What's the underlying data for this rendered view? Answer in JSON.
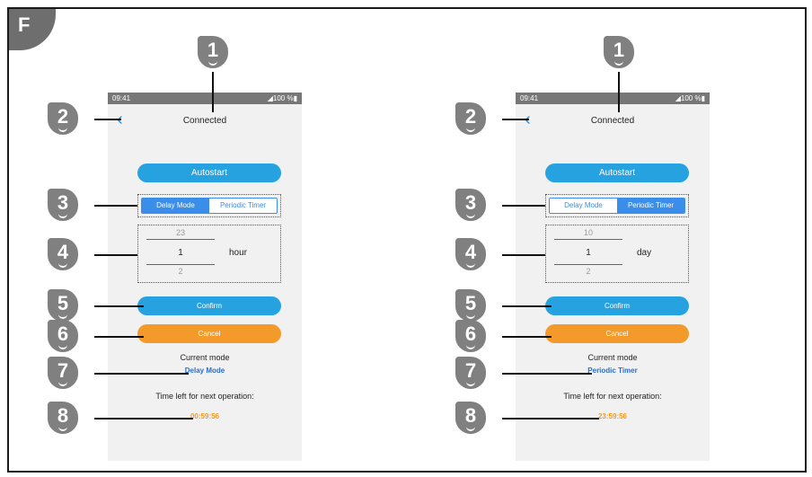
{
  "figure_label": "F",
  "panels": [
    {
      "status": {
        "time": "09:41",
        "battery": "100 %"
      },
      "title": "Connected",
      "autostart_label": "Autostart",
      "modes": [
        "Delay Mode",
        "Periodic Timer"
      ],
      "active_mode": 0,
      "picker": {
        "prev": "23",
        "current": "1",
        "next": "2",
        "unit": "hour"
      },
      "confirm_label": "Confirm",
      "cancel_label": "Cancel",
      "current_mode_label": "Current mode",
      "current_mode_value": "Delay Mode",
      "time_left_label": "Time left for next operation:",
      "time_left_value": "00:59:56"
    },
    {
      "status": {
        "time": "09:41",
        "battery": "100 %"
      },
      "title": "Connected",
      "autostart_label": "Autostart",
      "modes": [
        "Delay Mode",
        "Periodic Timer"
      ],
      "active_mode": 1,
      "picker": {
        "prev": "10",
        "current": "1",
        "next": "2",
        "unit": "day"
      },
      "confirm_label": "Confirm",
      "cancel_label": "Cancel",
      "current_mode_label": "Current mode",
      "current_mode_value": "Periodic Timer",
      "time_left_label": "Time left for next operation:",
      "time_left_value": "23:59:56"
    }
  ],
  "callout_numbers": [
    "1",
    "2",
    "3",
    "4",
    "5",
    "6",
    "7",
    "8"
  ],
  "colors": {
    "primary": "#27a2e0",
    "segment": "#3a8de8",
    "cancel": "#f39a2b",
    "badge": "#808080"
  }
}
